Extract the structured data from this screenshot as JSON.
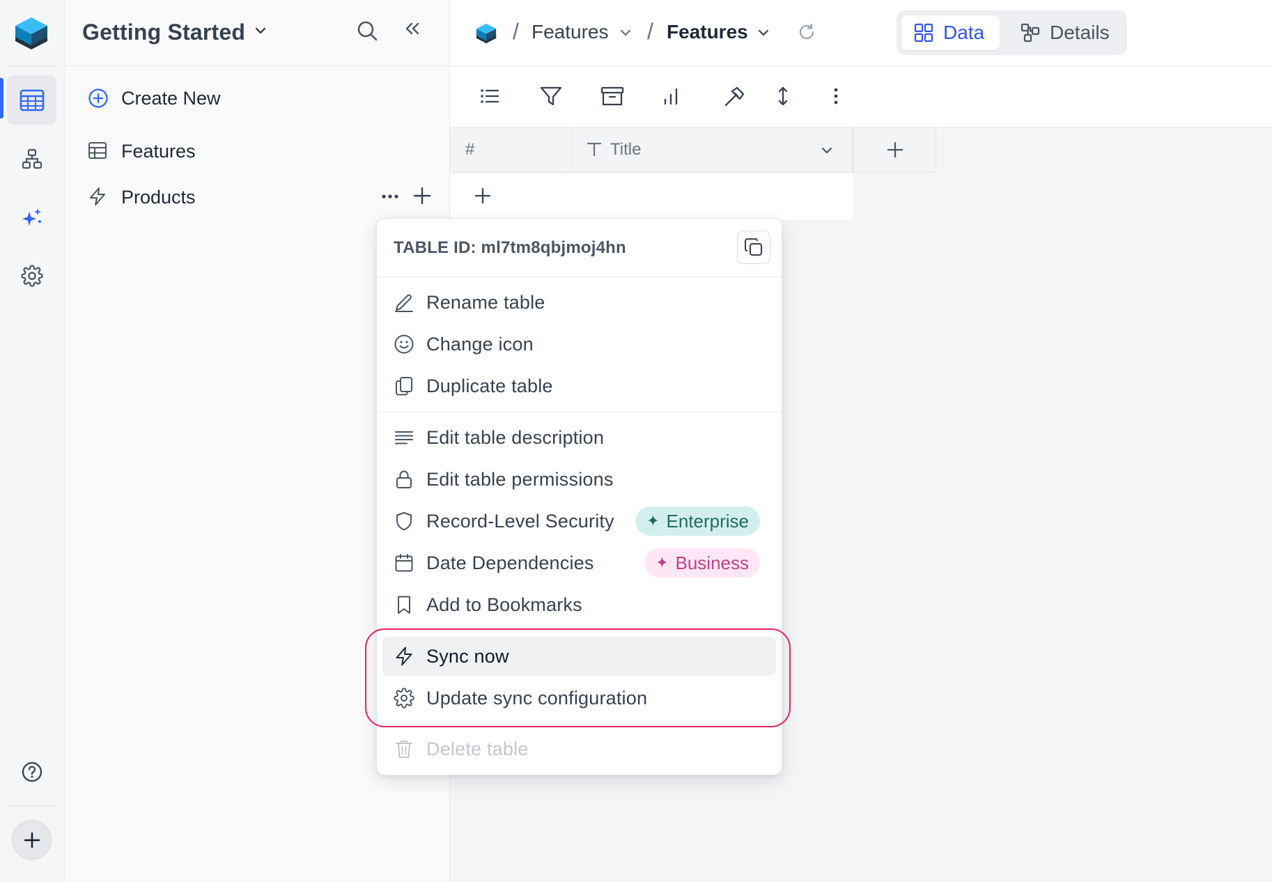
{
  "workspace": {
    "title": "Getting Started"
  },
  "sidebar": {
    "create_new_label": "Create New",
    "tables": [
      {
        "label": "Features",
        "icon": "table-icon"
      },
      {
        "label": "Products",
        "icon": "lightning-icon"
      }
    ]
  },
  "breadcrumb": {
    "items": [
      "Features",
      "Features"
    ]
  },
  "view_switch": {
    "data_label": "Data",
    "details_label": "Details",
    "selected": "Data"
  },
  "grid": {
    "columns": [
      {
        "label": "#"
      },
      {
        "label": "Title",
        "type_icon": "text-type-icon"
      }
    ]
  },
  "context_menu": {
    "table_id_text": "TABLE ID: ml7tm8qbjmoj4hn",
    "items": [
      {
        "label": "Rename table",
        "icon": "pencil-icon"
      },
      {
        "label": "Change icon",
        "icon": "smiley-icon"
      },
      {
        "label": "Duplicate table",
        "icon": "duplicate-icon"
      },
      {
        "label": "Edit table description",
        "icon": "lines-icon"
      },
      {
        "label": "Edit table permissions",
        "icon": "lock-icon"
      },
      {
        "label": "Record-Level Security",
        "icon": "shield-icon",
        "badge": "Enterprise"
      },
      {
        "label": "Date Dependencies",
        "icon": "calendar-icon",
        "badge": "Business"
      },
      {
        "label": "Add to Bookmarks",
        "icon": "bookmark-icon"
      },
      {
        "label": "Sync now",
        "icon": "lightning-icon",
        "hovered": true
      },
      {
        "label": "Update sync configuration",
        "icon": "gear-icon"
      },
      {
        "label": "Delete table",
        "icon": "trash-icon",
        "disabled": true
      }
    ]
  },
  "colors": {
    "accent": "#3366ff",
    "highlight": "#e0245e",
    "enterprise_badge_bg": "#d3efed",
    "business_badge_bg": "#fde7f4"
  }
}
